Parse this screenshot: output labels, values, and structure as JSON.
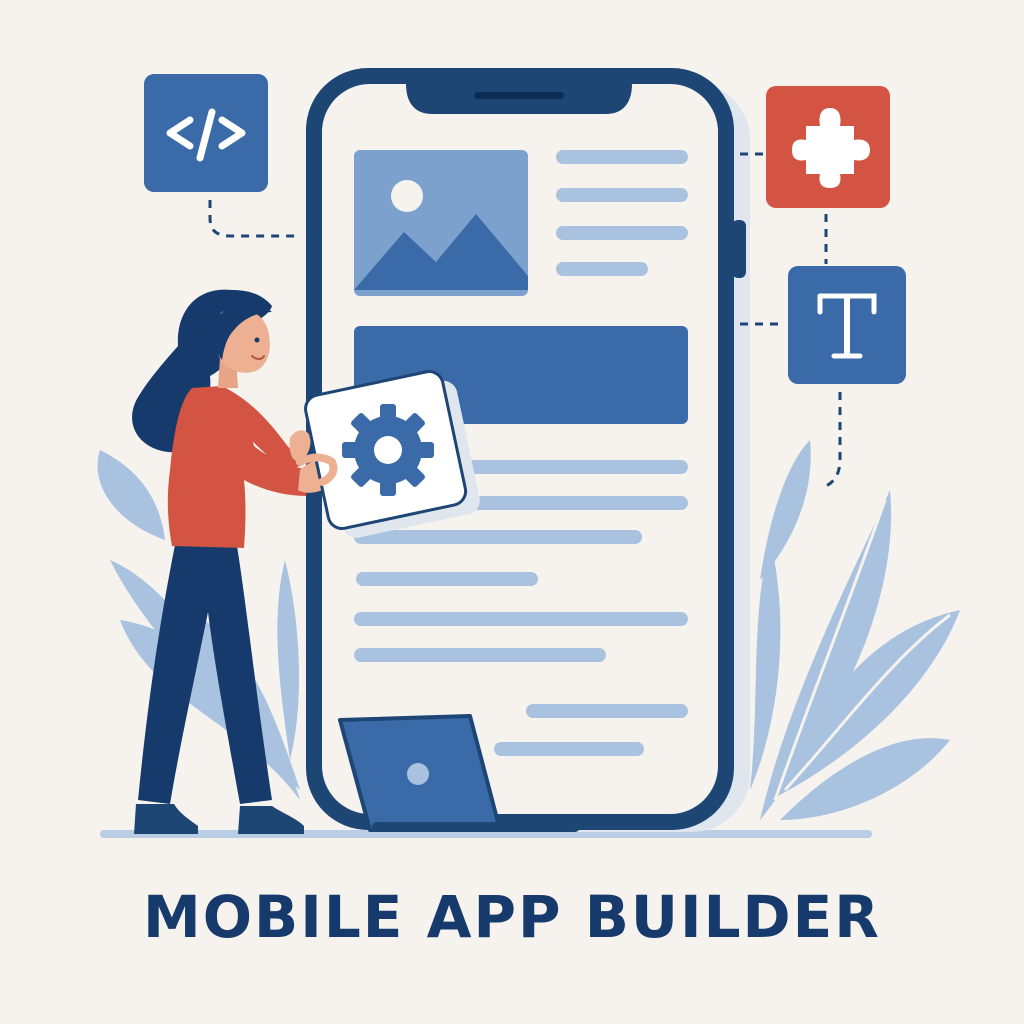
{
  "title": "MOBILE APP BUILDER",
  "icons": {
    "code": "code-icon",
    "puzzle": "puzzle-piece-icon",
    "text": "text-tool-icon",
    "gear": "gear-icon",
    "image": "image-placeholder-icon"
  },
  "colors": {
    "background": "#f6f3ee",
    "navy": "#1d4675",
    "blue": "#3a6aa8",
    "light_blue": "#a9c2df",
    "red": "#d45443",
    "title": "#163a6b"
  }
}
